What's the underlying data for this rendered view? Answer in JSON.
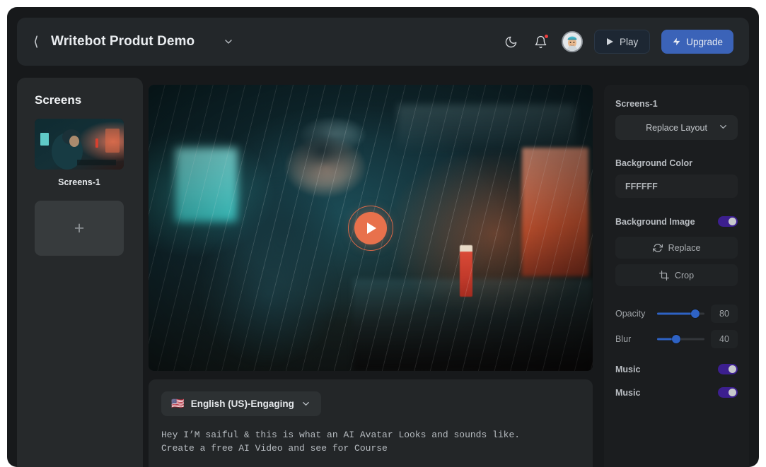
{
  "header": {
    "back_icon": "chevron-left-icon",
    "title": "Writebot Produt Demo",
    "title_caret_icon": "chevron-down-icon",
    "dark_mode_icon": "moon-icon",
    "notifications_icon": "bell-icon",
    "avatar_icon": "user-avatar",
    "play_label": "Play",
    "play_icon": "play-triangle-icon",
    "upgrade_label": "Upgrade",
    "upgrade_icon": "lightning-bolt-icon",
    "upgrade_color": "#3b63b8"
  },
  "sidebar": {
    "title": "Screens",
    "screens": [
      {
        "label": "Screens-1"
      }
    ],
    "add_icon": "plus-icon"
  },
  "canvas": {
    "play_button_icon": "play-circle-icon",
    "play_accent_color": "#e8714c"
  },
  "script": {
    "language_flag": "🇺🇸",
    "language_label": "English (US)-Engaging",
    "language_caret_icon": "chevron-down-icon",
    "text": "Hey I’M saiful & this is what an AI Avatar Looks and sounds like.\nCreate a free AI Video and see for Course"
  },
  "properties": {
    "screen_name": "Screens-1",
    "layout_select_value": "Replace  Layout",
    "layout_caret_icon": "chevron-down-icon",
    "background_color_label": "Background Color",
    "background_color_value": "FFFFFF",
    "background_image_label": "Background Image",
    "background_image_enabled": true,
    "replace_label": "Replace",
    "replace_icon": "refresh-icon",
    "crop_label": "Crop",
    "crop_icon": "crop-icon",
    "sliders": [
      {
        "label": "Opacity",
        "value": "80",
        "percent": 80
      },
      {
        "label": "Blur",
        "value": "40",
        "percent": 40
      }
    ],
    "toggles": [
      {
        "label": "Music",
        "enabled": true
      },
      {
        "label": "Music",
        "enabled": true
      }
    ],
    "toggle_color": "#3c1f8f",
    "slider_color": "#2e62c4"
  }
}
